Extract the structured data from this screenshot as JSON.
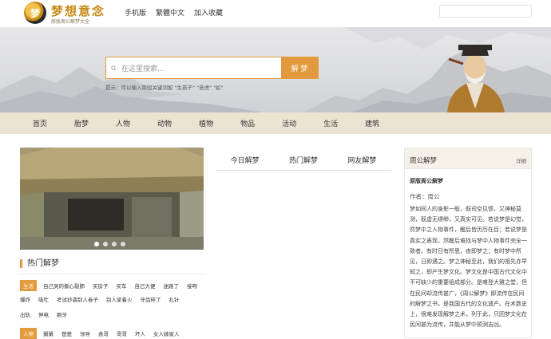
{
  "header": {
    "logo_glyph": "梦",
    "logo_title": "梦想意念",
    "logo_subtitle": "原版周公解梦大全",
    "nav": [
      "手机版",
      "繁體中文",
      "加入收藏"
    ]
  },
  "banner": {
    "search_placeholder": "在这里搜索...",
    "search_button": "解 梦",
    "hint": "提示：可以输入简短关键词如 \"生孩子\"  \"老虎\"  \"蛇\""
  },
  "categories": [
    "首页",
    "胎梦",
    "人物",
    "动物",
    "植物",
    "物品",
    "活动",
    "生活",
    "建筑"
  ],
  "left": {
    "section_title": "热门解梦",
    "tags_row1": [
      "生活",
      "自己哭的撕心裂肺",
      "买房子",
      "买车",
      "自己大便",
      "迷路了",
      "接吻"
    ],
    "tags_row2": [
      "爆炸",
      "吸吐",
      "考试抄袭别人卷子",
      "别人家着火",
      "牙齿碎了",
      "扎针"
    ],
    "tags_row3": [
      "出轨",
      "停电",
      "刷牙"
    ],
    "tags_row4": [
      "人物",
      "舅舅",
      "爸爸",
      "领导",
      "表哥",
      "哥哥",
      "坏人",
      "女人嫁家人"
    ]
  },
  "tabs": [
    "今日解梦",
    "热门解梦",
    "网友解梦"
  ],
  "right": {
    "title": "周公解梦",
    "more": "详细",
    "subtitle": "原版周公解梦",
    "author": "作者：周公",
    "body": "梦如同人的身影一般，既司空见惯，又神秘莫测，既虚无缥缈，又真实可见。若说梦是幻觉，然梦中之人物事件，醒后皆历历在目；若说梦是真实之表现，然醒后难找与梦中人物事件完全一致者。有时日有所思，夜即梦之；有时梦中所见，日即遇之。梦之神秘至此，我们的祖先亦早知之，即产生梦文化。梦文化是中国古代文化中不可缺少的重要组成部分。是难登大雅之堂，但在民间却流传甚广，《周公解梦》即流传在民间的解梦之书，是我国古代的文化遗产。在术数史上，很难发现解梦之术，列于此，只因梦文化在民间甚为流传，并能从梦中预测吉凶。"
  },
  "colors": {
    "accent": "#e39a3e",
    "catbar": "#ede3d3"
  }
}
